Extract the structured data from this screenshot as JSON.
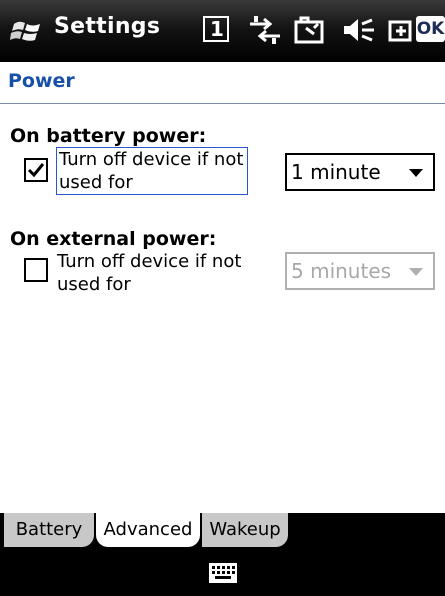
{
  "titlebar": {
    "title": "Settings",
    "start_icon": "windows-flag-icon",
    "status_icons": [
      "notification-1-icon",
      "connectivity-icon",
      "battery-icon",
      "volume-muted-icon",
      "toggle-icon"
    ],
    "indicator_number": "1",
    "ok_label": "OK"
  },
  "page": {
    "title": "Power"
  },
  "battery": {
    "heading": "On battery power:",
    "checkbox_label": "Turn off device if not used for",
    "checked": true,
    "timeout_value": "1 minute"
  },
  "external": {
    "heading": "On external power:",
    "checkbox_label": "Turn off device if not used for",
    "checked": false,
    "timeout_value": "5 minutes"
  },
  "tabs": [
    {
      "label": "Battery",
      "active": false
    },
    {
      "label": "Advanced",
      "active": true
    },
    {
      "label": "Wakeup",
      "active": false
    }
  ],
  "bottombar": {
    "icon": "keyboard-icon"
  },
  "colors": {
    "accent": "#1850a8",
    "focus_border": "#2a58c8",
    "tab_inactive": "#c8c8c8",
    "disabled_text": "#a8a8a8"
  }
}
